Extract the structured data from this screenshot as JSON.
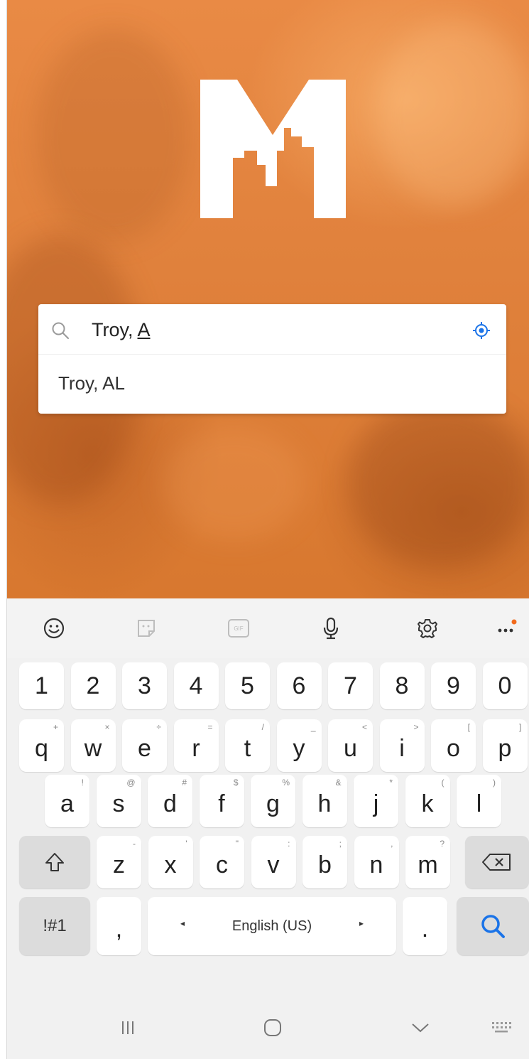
{
  "search": {
    "typed_prefix": "Troy, ",
    "typed_last": "A",
    "icon": "search-icon",
    "locate_icon": "crosshair-icon"
  },
  "suggestions": [
    {
      "label": "Troy, AL"
    }
  ],
  "colors": {
    "hero_orange": "#e0813c",
    "accent_blue": "#1a73e8",
    "keyboard_bg": "#f1f1f1"
  },
  "keyboard_toolbar": [
    {
      "name": "emoji-icon"
    },
    {
      "name": "sticker-icon"
    },
    {
      "name": "gif-icon",
      "label": "GIF"
    },
    {
      "name": "microphone-icon"
    },
    {
      "name": "settings-gear-icon"
    },
    {
      "name": "more-options-icon"
    }
  ],
  "keyboard": {
    "numbers": [
      "1",
      "2",
      "3",
      "4",
      "5",
      "6",
      "7",
      "8",
      "9",
      "0"
    ],
    "row_q": [
      {
        "k": "q",
        "h": "+"
      },
      {
        "k": "w",
        "h": "×"
      },
      {
        "k": "e",
        "h": "÷"
      },
      {
        "k": "r",
        "h": "="
      },
      {
        "k": "t",
        "h": "/"
      },
      {
        "k": "y",
        "h": "_"
      },
      {
        "k": "u",
        "h": "<"
      },
      {
        "k": "i",
        "h": ">"
      },
      {
        "k": "o",
        "h": "["
      },
      {
        "k": "p",
        "h": "]"
      }
    ],
    "row_a": [
      {
        "k": "a",
        "h": "!"
      },
      {
        "k": "s",
        "h": "@"
      },
      {
        "k": "d",
        "h": "#"
      },
      {
        "k": "f",
        "h": "$"
      },
      {
        "k": "g",
        "h": "%"
      },
      {
        "k": "h",
        "h": "&"
      },
      {
        "k": "j",
        "h": "*"
      },
      {
        "k": "k",
        "h": "("
      },
      {
        "k": "l",
        "h": ")"
      }
    ],
    "row_z": [
      {
        "k": "z",
        "h": "-"
      },
      {
        "k": "x",
        "h": "'"
      },
      {
        "k": "c",
        "h": "\""
      },
      {
        "k": "v",
        "h": ":"
      },
      {
        "k": "b",
        "h": ";"
      },
      {
        "k": "n",
        "h": ","
      },
      {
        "k": "m",
        "h": "?"
      }
    ],
    "symbols_label": "!#1",
    "comma_label": ",",
    "space_label": "English (US)",
    "period_label": ".",
    "left_arrow": "◂",
    "right_arrow": "▸"
  },
  "navbar": [
    {
      "name": "recent-apps-icon"
    },
    {
      "name": "home-icon"
    },
    {
      "name": "back-icon"
    },
    {
      "name": "keyboard-switch-icon"
    }
  ]
}
